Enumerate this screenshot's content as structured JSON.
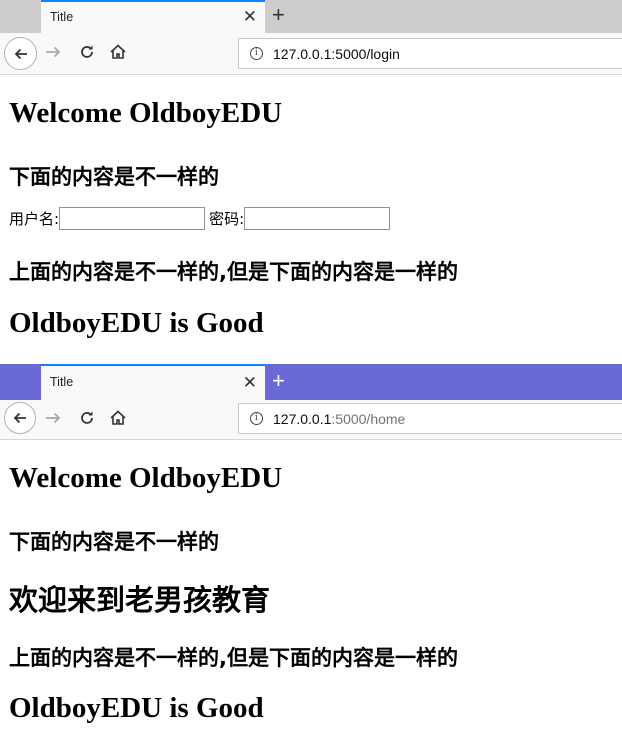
{
  "window1": {
    "tab_title": "Title",
    "url_host": "127.0.0.1",
    "url_rest": ":5000/login",
    "heading": "Welcome OldboyEDU",
    "subheading": "下面的内容是不一样的",
    "form": {
      "username_label": "用户名:",
      "username_value": "",
      "password_label": "密码:",
      "password_value": ""
    },
    "middle_heading": "上面的内容是不一样的,但是下面的内容是一样的",
    "footer_heading": "OldboyEDU is Good"
  },
  "window2": {
    "tab_title": "Title",
    "url_host": "127.0.0.1",
    "url_rest": ":5000/home",
    "heading": "Welcome OldboyEDU",
    "subheading": "下面的内容是不一样的",
    "welcome_text": "欢迎来到老男孩教育",
    "middle_heading": "上面的内容是不一样的,但是下面的内容是一样的",
    "footer_heading": "OldboyEDU is Good"
  },
  "colors": {
    "active_tab_line": "#0a84ff",
    "window2_titlebar": "#6b69d6",
    "window1_titlebar": "#cdcdcd"
  },
  "icons": [
    "back-arrow-icon",
    "forward-arrow-icon",
    "reload-icon",
    "home-icon",
    "info-icon",
    "close-icon",
    "plus-icon"
  ]
}
